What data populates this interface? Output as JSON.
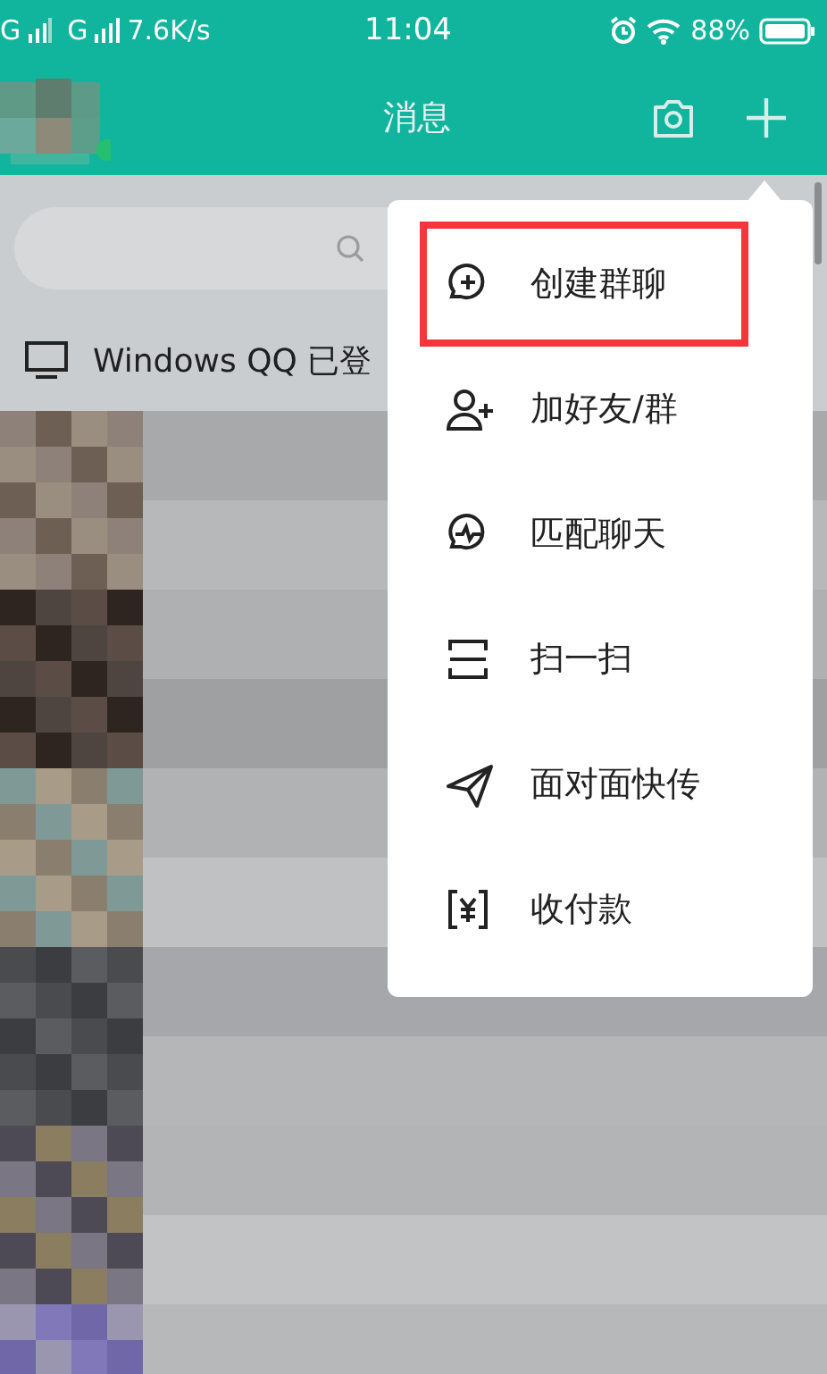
{
  "status_bar": {
    "carrier_1": "G",
    "carrier_2": "G",
    "speed": "7.6K/s",
    "time": "11:04",
    "battery": "88%"
  },
  "header": {
    "title": "消息"
  },
  "login_notice": {
    "text": "Windows QQ 已登"
  },
  "menu": {
    "items": [
      {
        "label": "创建群聊",
        "kind": "create-group",
        "highlighted": true
      },
      {
        "label": "加好友/群",
        "kind": "add-friend",
        "highlighted": false
      },
      {
        "label": "匹配聊天",
        "kind": "match-chat",
        "highlighted": false
      },
      {
        "label": "扫一扫",
        "kind": "scan",
        "highlighted": false
      },
      {
        "label": "面对面快传",
        "kind": "send",
        "highlighted": false
      },
      {
        "label": "收付款",
        "kind": "pay",
        "highlighted": false
      }
    ]
  }
}
